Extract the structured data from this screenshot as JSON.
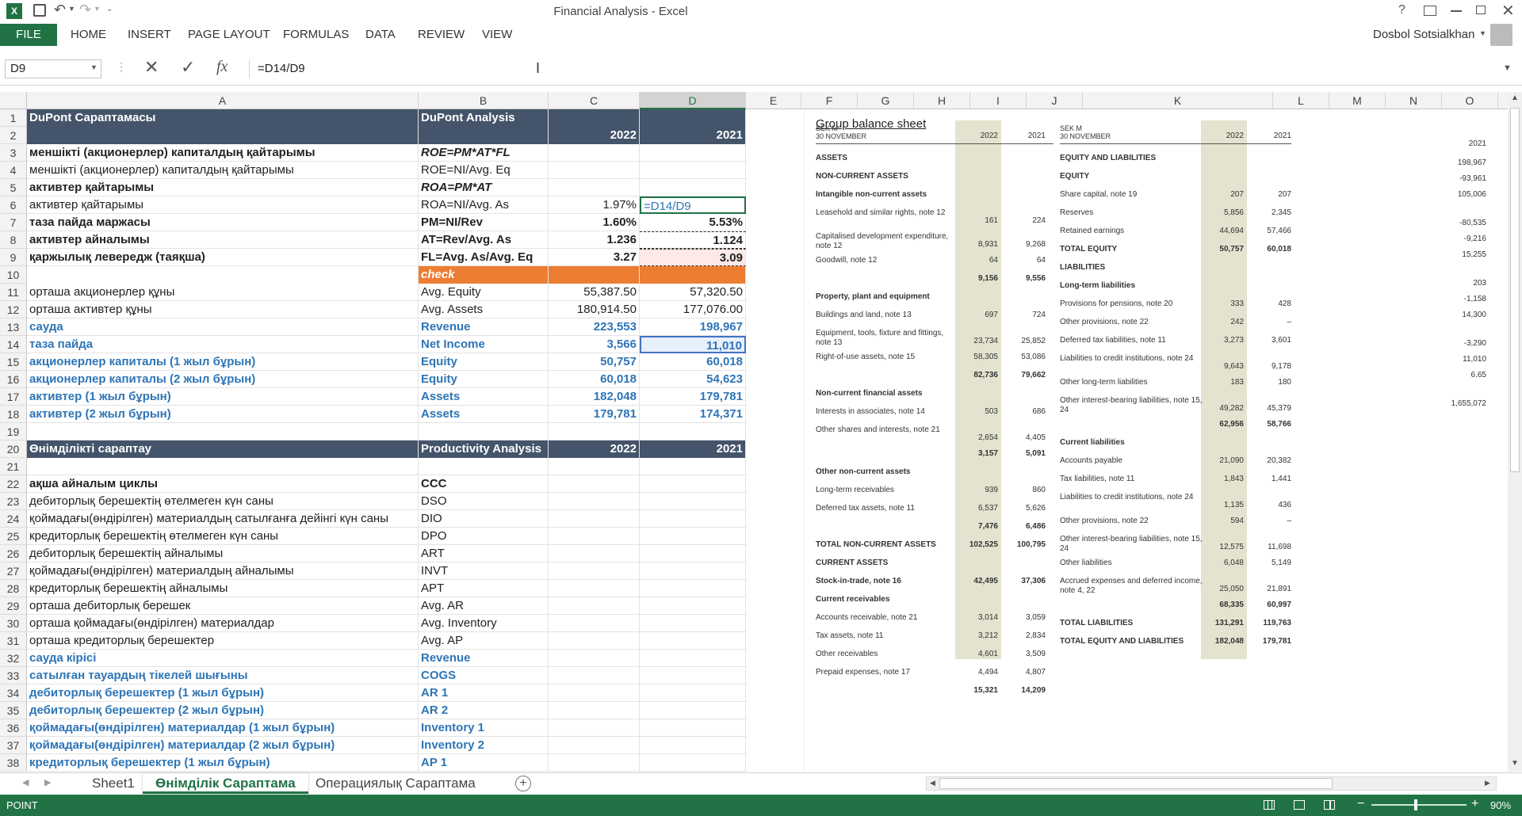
{
  "window": {
    "title": "Financial Analysis - Excel",
    "user": "Dosbol Sotsialkhan",
    "help": "?"
  },
  "ribbon": {
    "file": "FILE",
    "tabs": [
      "HOME",
      "INSERT",
      "PAGE LAYOUT",
      "FORMULAS",
      "DATA",
      "REVIEW",
      "VIEW"
    ]
  },
  "formula_bar": {
    "name_box": "D9",
    "formula": "=D14/D9",
    "fx": "fx"
  },
  "columns": [
    "A",
    "B",
    "C",
    "D",
    "E",
    "F",
    "G",
    "H",
    "I",
    "J",
    "K",
    "L",
    "M",
    "N",
    "O"
  ],
  "rows": [
    "1",
    "2",
    "3",
    "4",
    "5",
    "6",
    "7",
    "8",
    "9",
    "10",
    "11",
    "12",
    "13",
    "14",
    "15",
    "16",
    "17",
    "18",
    "19",
    "20",
    "21",
    "22",
    "23",
    "24",
    "25",
    "26",
    "27",
    "28",
    "29",
    "30",
    "31",
    "32",
    "33",
    "34",
    "35",
    "36",
    "37",
    "38"
  ],
  "cells": [
    {
      "a": "DuPont Сараптамасы",
      "b": "DuPont Analysis",
      "c": "",
      "d": "",
      "s": "dark"
    },
    {
      "a": "",
      "b": "",
      "c": "2022",
      "d": "2021",
      "s": "dark"
    },
    {
      "a": "меншікті (акционерлер) капиталдың қайтарымы",
      "b": "ROE=PM*AT*FL",
      "c": "",
      "d": "",
      "s": "bold-ital"
    },
    {
      "a": "меншікті (акционерлер) капиталдың қайтарымы",
      "b": "ROE=NI/Avg. Eq",
      "c": "",
      "d": "",
      "s": "plain"
    },
    {
      "a": "активтер қайтарымы",
      "b": "ROA=PM*AT",
      "c": "",
      "d": "",
      "s": "bold-ital"
    },
    {
      "a": "активтер қайтарымы",
      "b": "ROA=NI/Avg. As",
      "c": "1.97%",
      "d": "=D14/D9",
      "s": "plain-edit"
    },
    {
      "a": "таза пайда маржасы",
      "b": "PM=NI/Rev",
      "c": "1.60%",
      "d": "5.53%",
      "s": "bold"
    },
    {
      "a": "активтер айналымы",
      "b": "AT=Rev/Avg. As",
      "c": "1.236",
      "d": "1.124",
      "s": "bold"
    },
    {
      "a": "қаржылық левередж (таяқша)",
      "b": "FL=Avg. As/Avg. Eq",
      "c": "3.27",
      "d": "3.09",
      "s": "bold"
    },
    {
      "a": "",
      "b": "check",
      "c": "",
      "d": "",
      "s": "check"
    },
    {
      "a": "орташа акционерлер құны",
      "b": "Avg. Equity",
      "c": "55,387.50",
      "d": "57,320.50",
      "s": "plain"
    },
    {
      "a": "орташа активтер құны",
      "b": "Avg. Assets",
      "c": "180,914.50",
      "d": "177,076.00",
      "s": "plain"
    },
    {
      "a": "сауда",
      "b": "Revenue",
      "c": "223,553",
      "d": "198,967",
      "s": "blue"
    },
    {
      "a": "таза пайда",
      "b": "Net Income",
      "c": "3,566",
      "d": "11,010",
      "s": "blue"
    },
    {
      "a": "акционерлер капиталы  (1 жыл бұрын)",
      "b": "Equity",
      "c": "50,757",
      "d": "60,018",
      "s": "blue"
    },
    {
      "a": "акционерлер капиталы  (2 жыл бұрын)",
      "b": "Equity",
      "c": "60,018",
      "d": "54,623",
      "s": "blue"
    },
    {
      "a": "активтер  (1 жыл бұрын)",
      "b": "Assets",
      "c": "182,048",
      "d": "179,781",
      "s": "blue"
    },
    {
      "a": "активтер  (2 жыл бұрын)",
      "b": "Assets",
      "c": "179,781",
      "d": "174,371",
      "s": "blue"
    },
    {
      "a": "",
      "b": "",
      "c": "",
      "d": "",
      "s": "plain"
    },
    {
      "a": "Өнімділікті сараптау",
      "b": "Productivity Analysis",
      "c": "2022",
      "d": "2021",
      "s": "dark"
    },
    {
      "a": "",
      "b": "",
      "c": "",
      "d": "",
      "s": "plain"
    },
    {
      "a": "ақша айналым циклы",
      "b": "CCC",
      "c": "",
      "d": "",
      "s": "bold"
    },
    {
      "a": "дебиторлық берешектің өтелмеген күн саны",
      "b": "DSO",
      "c": "",
      "d": "",
      "s": "plain"
    },
    {
      "a": "қоймадағы(өндірілген) материалдың сатылғанға дейінгі күн саны",
      "b": "DIO",
      "c": "",
      "d": "",
      "s": "plain"
    },
    {
      "a": "кредиторлық берешектің өтелмеген күн саны",
      "b": "DPO",
      "c": "",
      "d": "",
      "s": "plain"
    },
    {
      "a": "дебиторлық берешектің айналымы",
      "b": "ART",
      "c": "",
      "d": "",
      "s": "plain"
    },
    {
      "a": "қоймадағы(өндірілген) материалдың айналымы",
      "b": "INVT",
      "c": "",
      "d": "",
      "s": "plain"
    },
    {
      "a": "кредиторлық берешектің айналымы",
      "b": "APT",
      "c": "",
      "d": "",
      "s": "plain"
    },
    {
      "a": "орташа дебиторлық берешек",
      "b": "Avg. AR",
      "c": "",
      "d": "",
      "s": "plain"
    },
    {
      "a": "орташа қоймадағы(өндірілген) материалдар",
      "b": "Avg. Inventory",
      "c": "",
      "d": "",
      "s": "plain"
    },
    {
      "a": "орташа кредиторлық берешектер",
      "b": "Avg. AP",
      "c": "",
      "d": "",
      "s": "plain"
    },
    {
      "a": "сауда кірісі",
      "b": "Revenue",
      "c": "",
      "d": "",
      "s": "blue"
    },
    {
      "a": "сатылған тауардың тікелей шығыны",
      "b": "COGS",
      "c": "",
      "d": "",
      "s": "blue"
    },
    {
      "a": "дебиторлық берешектер  (1 жыл бұрын)",
      "b": "AR 1",
      "c": "",
      "d": "",
      "s": "blue"
    },
    {
      "a": "дебиторлық берешектер  (2 жыл бұрын)",
      "b": "AR 2",
      "c": "",
      "d": "",
      "s": "blue"
    },
    {
      "a": "қоймадағы(өндірілген) материалдар  (1 жыл бұрын)",
      "b": "Inventory 1",
      "c": "",
      "d": "",
      "s": "blue"
    },
    {
      "a": "қоймадағы(өндірілген) материалдар  (2 жыл бұрын)",
      "b": "Inventory 2",
      "c": "",
      "d": "",
      "s": "blue"
    },
    {
      "a": "кредиторлық берешектер (1 жыл бұрын)",
      "b": "AP 1",
      "c": "",
      "d": "",
      "s": "blue"
    }
  ],
  "balance_sheet": {
    "title": "Group balance sheet",
    "unit_left": "SEK M\n30 NOVEMBER",
    "y1": "2022",
    "y2": "2021",
    "left": [
      {
        "t": "ASSETS",
        "bold": true
      },
      {
        "t": "NON-CURRENT ASSETS",
        "bold": true
      },
      {
        "t": "Intangible non-current assets",
        "bold": true
      },
      {
        "t": "Leasehold and similar rights, note 12",
        "v1": "161",
        "v2": "224"
      },
      {
        "t": "Capitalised development expenditure, note 12",
        "v1": "8,931",
        "v2": "9,268"
      },
      {
        "t": "Goodwill, note 12",
        "v1": "64",
        "v2": "64"
      },
      {
        "t": "",
        "v1": "9,156",
        "v2": "9,556",
        "bold": true
      },
      {
        "t": "Property, plant and equipment",
        "bold": true
      },
      {
        "t": "Buildings and land, note 13",
        "v1": "697",
        "v2": "724"
      },
      {
        "t": "Equipment, tools, fixture and fittings, note 13",
        "v1": "23,734",
        "v2": "25,852"
      },
      {
        "t": "Right-of-use assets, note 15",
        "v1": "58,305",
        "v2": "53,086"
      },
      {
        "t": "",
        "v1": "82,736",
        "v2": "79,662",
        "bold": true
      },
      {
        "t": "Non-current financial assets",
        "bold": true
      },
      {
        "t": "Interests in associates, note 14",
        "v1": "503",
        "v2": "686"
      },
      {
        "t": "Other shares and interests, note 21",
        "v1": "2,654",
        "v2": "4,405"
      },
      {
        "t": "",
        "v1": "3,157",
        "v2": "5,091",
        "bold": true
      },
      {
        "t": "Other non-current assets",
        "bold": true
      },
      {
        "t": "Long-term receivables",
        "v1": "939",
        "v2": "860"
      },
      {
        "t": "Deferred tax assets, note 11",
        "v1": "6,537",
        "v2": "5,626"
      },
      {
        "t": "",
        "v1": "7,476",
        "v2": "6,486",
        "bold": true
      },
      {
        "t": "TOTAL NON-CURRENT ASSETS",
        "v1": "102,525",
        "v2": "100,795",
        "bold": true
      },
      {
        "t": "CURRENT ASSETS",
        "bold": true
      },
      {
        "t": "Stock-in-trade, note 16",
        "v1": "42,495",
        "v2": "37,306",
        "bold": true
      },
      {
        "t": "Current receivables",
        "bold": true
      },
      {
        "t": "Accounts receivable, note 21",
        "v1": "3,014",
        "v2": "3,059"
      },
      {
        "t": "Tax assets, note 11",
        "v1": "3,212",
        "v2": "2,834"
      },
      {
        "t": "Other receivables",
        "v1": "4,601",
        "v2": "3,509"
      },
      {
        "t": "Prepaid expenses, note 17",
        "v1": "4,494",
        "v2": "4,807"
      },
      {
        "t": "",
        "v1": "15,321",
        "v2": "14,209",
        "bold": true
      }
    ],
    "right": [
      {
        "t": "EQUITY AND LIABILITIES",
        "bold": true
      },
      {
        "t": "EQUITY",
        "bold": true
      },
      {
        "t": "Share capital, note 19",
        "v1": "207",
        "v2": "207"
      },
      {
        "t": "Reserves",
        "v1": "5,856",
        "v2": "2,345"
      },
      {
        "t": "Retained earnings",
        "v1": "44,694",
        "v2": "57,466"
      },
      {
        "t": "TOTAL EQUITY",
        "v1": "50,757",
        "v2": "60,018",
        "bold": true
      },
      {
        "t": "LIABILITIES",
        "bold": true
      },
      {
        "t": "Long-term liabilities",
        "bold": true
      },
      {
        "t": "Provisions for pensions, note 20",
        "v1": "333",
        "v2": "428"
      },
      {
        "t": "Other provisions, note 22",
        "v1": "242",
        "v2": "–"
      },
      {
        "t": "Deferred tax liabilities, note 11",
        "v1": "3,273",
        "v2": "3,601"
      },
      {
        "t": "Liabilities to credit institutions, note 24",
        "v1": "9,643",
        "v2": "9,178"
      },
      {
        "t": "Other long-term liabilities",
        "v1": "183",
        "v2": "180"
      },
      {
        "t": "Other interest-bearing liabilities, note 15, 24",
        "v1": "49,282",
        "v2": "45,379"
      },
      {
        "t": "",
        "v1": "62,956",
        "v2": "58,766",
        "bold": true
      },
      {
        "t": "Current liabilities",
        "bold": true
      },
      {
        "t": "Accounts payable",
        "v1": "21,090",
        "v2": "20,382"
      },
      {
        "t": "Tax liabilities, note 11",
        "v1": "1,843",
        "v2": "1,441"
      },
      {
        "t": "Liabilities to credit institutions, note 24",
        "v1": "1,135",
        "v2": "436"
      },
      {
        "t": "Other provisions, note 22",
        "v1": "594",
        "v2": "–"
      },
      {
        "t": "Other interest-bearing liabilities, note 15, 24",
        "v1": "12,575",
        "v2": "11,698"
      },
      {
        "t": "Other liabilities",
        "v1": "6,048",
        "v2": "5,149"
      },
      {
        "t": "Accrued expenses and deferred income, note 4, 22",
        "v1": "25,050",
        "v2": "21,891"
      },
      {
        "t": "",
        "v1": "68,335",
        "v2": "60,997",
        "bold": true
      },
      {
        "t": "TOTAL LIABILITIES",
        "v1": "131,291",
        "v2": "119,763",
        "bold": true
      },
      {
        "t": "TOTAL EQUITY AND LIABILITIES",
        "v1": "182,048",
        "v2": "179,781",
        "bold": true
      }
    ],
    "far_right": [
      "2021",
      "198,967",
      "-93,961",
      "105,006",
      "-80,535",
      "-9,216",
      "15,255",
      "203",
      "-1,158",
      "14,300",
      "-3,290",
      "11,010",
      "6.65",
      "1,655,072"
    ]
  },
  "sheets": [
    "Sheet1",
    "Өнімділік Сараптама",
    "Операциялық Сараптама"
  ],
  "active_sheet": "Өнімділік Сараптама",
  "status": {
    "mode": "POINT",
    "zoom": "90%"
  }
}
